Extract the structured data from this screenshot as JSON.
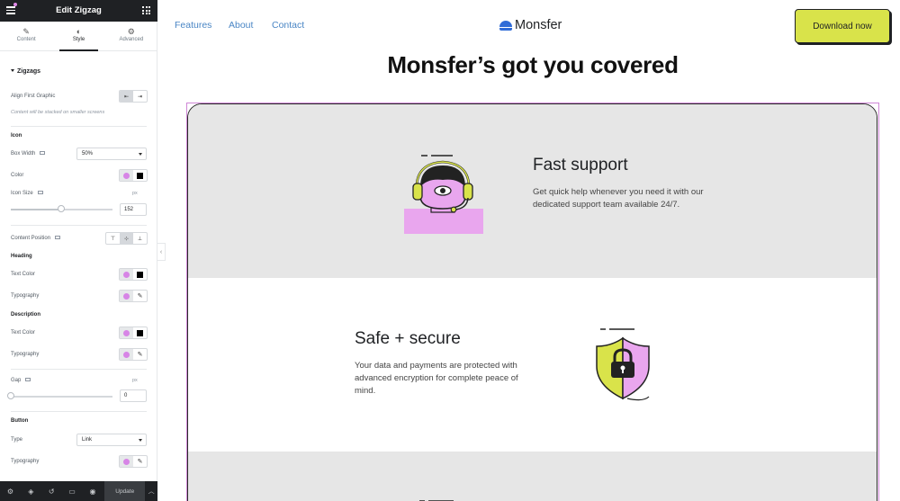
{
  "editor": {
    "title": "Edit Zigzag",
    "tabs": [
      {
        "label": "Content",
        "icon": "pencil-icon"
      },
      {
        "label": "Style",
        "icon": "half-circle-icon"
      },
      {
        "label": "Advanced",
        "icon": "gear-icon"
      }
    ],
    "section_title": "Zigzags",
    "align_first_graphic": "Align First Graphic",
    "stack_note": "Content will be stacked on smaller screens",
    "icon_heading": "Icon",
    "box_width_label": "Box Width",
    "box_width_value": "50%",
    "color_label": "Color",
    "icon_size_label": "Icon Size",
    "icon_size_unit": "px",
    "icon_size_value": "152",
    "content_position_label": "Content Position",
    "heading_heading": "Heading",
    "heading_text_color_label": "Text Color",
    "heading_typography_label": "Typography",
    "description_heading": "Description",
    "description_text_color_label": "Text Color",
    "description_typography_label": "Typography",
    "gap_label": "Gap",
    "gap_unit": "px",
    "gap_value": "0",
    "button_heading": "Button",
    "type_label": "Type",
    "type_value": "Link",
    "button_typography_label": "Typography",
    "update_label": "Update"
  },
  "site": {
    "nav": [
      "Features",
      "About",
      "Contact"
    ],
    "logo_text": "Monsfer",
    "download_label": "Download now",
    "headline": "Monsfer’s got you covered",
    "rows": [
      {
        "title": "Fast support",
        "description": "Get quick help whenever you need it with our dedicated support team available 24/7.",
        "illustration": "support-agent-illustration"
      },
      {
        "title": "Safe + secure",
        "description": "Your data and payments are protected with advanced encryption for complete peace of mind.",
        "illustration": "shield-lock-illustration"
      }
    ]
  },
  "colors": {
    "accent_lime": "#d9e34a",
    "accent_pink": "#e9a6ee",
    "link_blue": "#4a86c5",
    "brand_blue": "#2f6bd7",
    "row_gray": "#e6e6e6",
    "editor_dark": "#1f2124"
  }
}
